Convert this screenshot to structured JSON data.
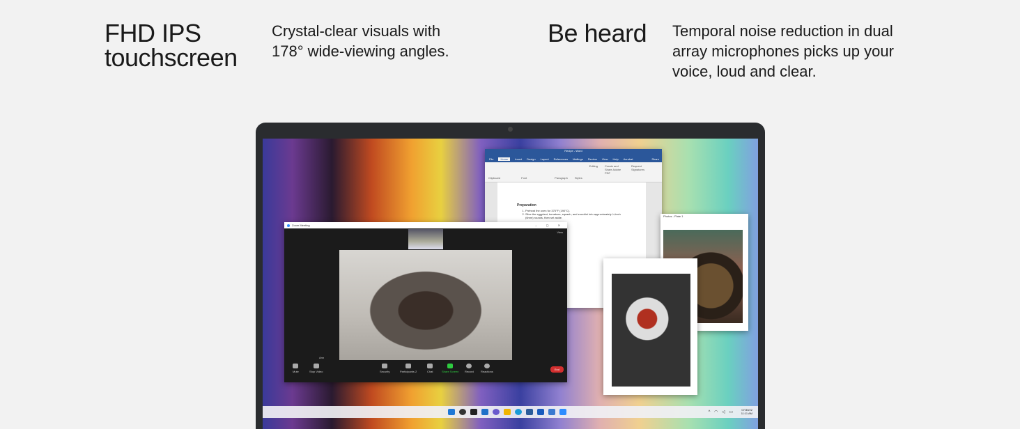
{
  "features": [
    {
      "title": "FHD IPS touchscreen",
      "description": "Crystal-clear visuals with 178° wide-viewing angles."
    },
    {
      "title": "Be heard",
      "description": "Temporal noise reduction in dual array microphones picks up your voice, loud and clear."
    }
  ],
  "word": {
    "title": "Recipe - Word",
    "tabs": [
      "File",
      "Home",
      "Insert",
      "Design",
      "Layout",
      "References",
      "Mailings",
      "Review",
      "View",
      "Help",
      "Acrobat"
    ],
    "search": "Share",
    "ribbon_groups": [
      "Clipboard",
      "Font",
      "Paragraph",
      "Styles",
      "Editing",
      "Create and Share Adobe PDF",
      "Request Signatures"
    ],
    "heading": "Preparation",
    "steps": [
      "Preheat the oven for 375°F (190°C).",
      "Slice the eggplant, tomatoes, squash, and zucchini into approximately ¼-inch (6mm) rounds, then set aside."
    ]
  },
  "zoom": {
    "title": "Zoom Meeting",
    "view": "View",
    "name_tag": "Ann",
    "controls": [
      "Mute",
      "Stop Video",
      "Security",
      "Participants",
      "Chat",
      "Share Screen",
      "Record",
      "Reactions"
    ],
    "participants_count": "2",
    "end": "End"
  },
  "photos": {
    "title": "Photos - Plate 1"
  },
  "taskbar": {
    "date": "07/30/22",
    "time": "11:11 AM",
    "icons": [
      "start-icon",
      "search-icon",
      "task-view-icon",
      "widgets-icon",
      "chat-icon",
      "file-explorer-icon",
      "edge-icon",
      "store-icon",
      "word-icon",
      "photos-icon",
      "zoom-icon"
    ]
  }
}
